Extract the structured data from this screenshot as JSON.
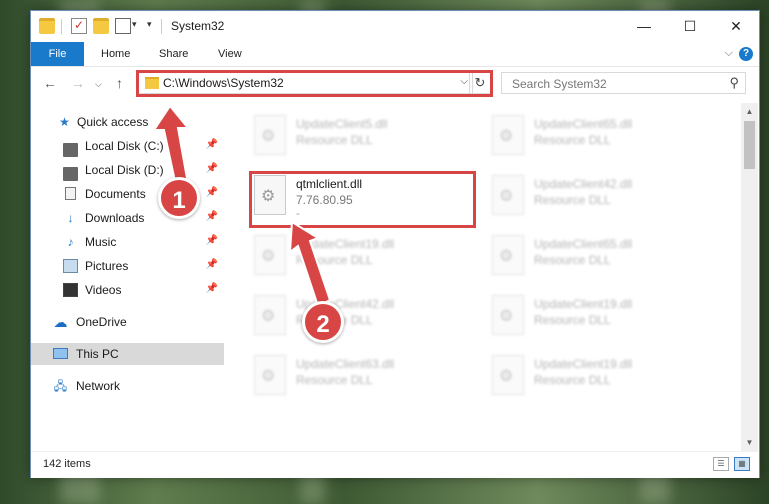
{
  "window": {
    "title": "System32",
    "controls": {
      "minimize": "—",
      "maximize": "☐",
      "close": "✕"
    }
  },
  "ribbon": {
    "tabs": [
      "File",
      "Home",
      "Share",
      "View"
    ],
    "expand": "⌵",
    "help": "?"
  },
  "address": {
    "path": "C:\\Windows\\System32",
    "search_placeholder": "Search System32"
  },
  "sidebar": {
    "quick_access": "Quick access",
    "items": [
      {
        "label": "Local Disk (C:)",
        "pinned": true
      },
      {
        "label": "Local Disk (D:)",
        "pinned": true
      },
      {
        "label": "Documents",
        "pinned": true
      },
      {
        "label": "Downloads",
        "pinned": true
      },
      {
        "label": "Music",
        "pinned": true
      },
      {
        "label": "Pictures",
        "pinned": true
      },
      {
        "label": "Videos",
        "pinned": true
      }
    ],
    "onedrive": "OneDrive",
    "this_pc": "This PC",
    "network": "Network"
  },
  "files": {
    "highlighted": {
      "name": "qtmlclient.dll",
      "version": "7.76.80.95",
      "desc": "-"
    },
    "blurred": [
      {
        "name": "UpdateClient5.dll",
        "desc": "Resource DLL"
      },
      {
        "name": "UpdateClient65.dll",
        "desc": "Resource DLL"
      },
      {
        "name": "UpdateClient42.dll",
        "desc": "Resource DLL"
      },
      {
        "name": "UpdateClient19.dll",
        "desc": "Resource DLL"
      },
      {
        "name": "UpdateClient65.dll",
        "desc": "Resource DLL"
      },
      {
        "name": "UpdateClient42.dll",
        "desc": "Resource DLL"
      },
      {
        "name": "UpdateClient19.dll",
        "desc": "Resource DLL"
      },
      {
        "name": "UpdateClient63.dll",
        "desc": "Resource DLL"
      },
      {
        "name": "UpdateClient19.dll",
        "desc": "Resource DLL"
      }
    ]
  },
  "status": {
    "count": "142 items"
  },
  "callouts": {
    "one": "1",
    "two": "2"
  },
  "colors": {
    "accent": "#1979ca",
    "highlight": "#d84545",
    "selected": "#d9d9d9"
  }
}
